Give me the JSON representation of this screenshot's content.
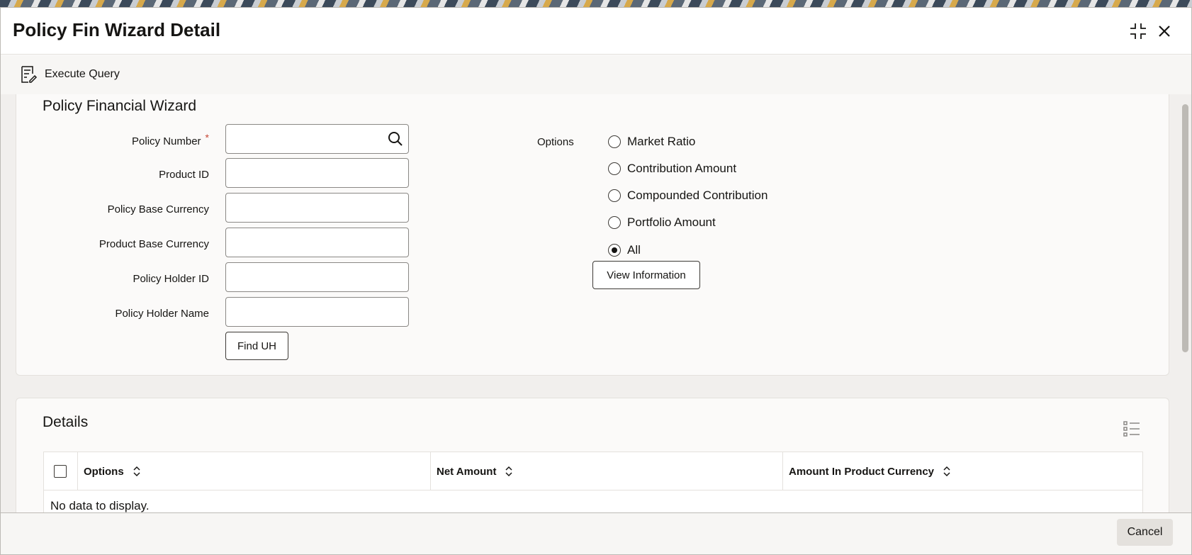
{
  "window": {
    "title": "Policy Fin Wizard Detail"
  },
  "toolbar": {
    "execute_query_label": "Execute Query"
  },
  "wizard": {
    "section_title": "Policy Financial Wizard",
    "fields": [
      {
        "label": "Policy Number",
        "required": "*",
        "value": ""
      },
      {
        "label": "Product ID",
        "value": ""
      },
      {
        "label": "Policy Base Currency",
        "value": ""
      },
      {
        "label": "Product Base Currency",
        "value": ""
      },
      {
        "label": "Policy Holder ID",
        "value": ""
      },
      {
        "label": "Policy Holder Name",
        "value": ""
      }
    ],
    "find_uh_label": "Find UH",
    "options_label": "Options",
    "options": [
      {
        "label": "Market Ratio",
        "selected": false
      },
      {
        "label": "Contribution Amount",
        "selected": false
      },
      {
        "label": "Compounded Contribution",
        "selected": false
      },
      {
        "label": "Portfolio Amount",
        "selected": false
      },
      {
        "label": "All",
        "selected": true
      }
    ],
    "view_information_label": "View Information"
  },
  "details": {
    "section_title": "Details",
    "columns": [
      "Options",
      "Net Amount",
      "Amount In Product Currency"
    ],
    "empty_message": "No data to display."
  },
  "footer": {
    "cancel_label": "Cancel"
  }
}
